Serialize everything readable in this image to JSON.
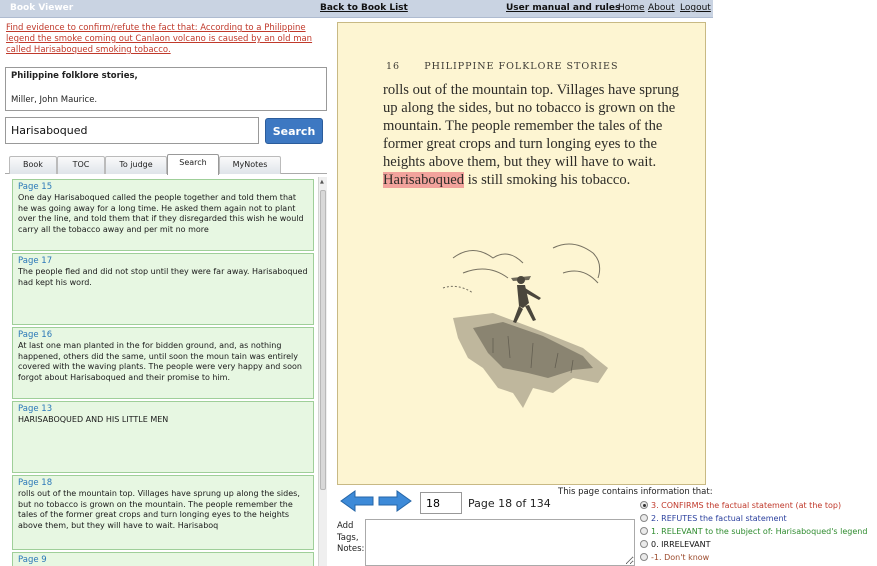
{
  "header": {
    "app_title": "Book Viewer",
    "back_link": "Back to Book List",
    "manual_link": "User manual and rules",
    "home_link": "Home",
    "about_link": "About",
    "logout_link": "Logout"
  },
  "task": "Find evidence to confirm/refute the fact that: According to a Philippine legend the smoke coming out Canlaon volcano is caused by an old man called Harisaboqued smoking tobacco.",
  "book": {
    "title": "Philippine folklore stories,",
    "author": "Miller, John Maurice."
  },
  "search": {
    "query": "Harisaboqued",
    "button_label": "Search"
  },
  "tabs": [
    "Book",
    "TOC",
    "To judge",
    "Search",
    "MyNotes"
  ],
  "active_tab": "Search",
  "results": [
    {
      "page": "Page 15",
      "text": "One day Harisaboqued called the people together and told them that he was going away for a long time. He asked them again not to plant over the line, and told them that if they disregarded this wish he would carry all the tobacco away and per mit no more"
    },
    {
      "page": "Page 17",
      "text": "The people fled and did not stop until they were far away. Harisaboqued had kept his word."
    },
    {
      "page": "Page 16",
      "text": "At last one man planted in the for bidden ground, and, as nothing happened, others did the same, until soon the moun tain was entirely covered with the waving plants. The people were very happy and soon forgot about Harisaboqued and their promise to him."
    },
    {
      "page": "Page 13",
      "text": "HARISABOQUED AND HIS LITTLE MEN"
    },
    {
      "page": "Page 18",
      "text": "rolls out of the mountain top. Villages have sprung up along the sides, but no tobacco is grown on the mountain. The people remember the tales of the former great crops and turn longing eyes to the heights above them, but they will have to wait. Harisaboq"
    },
    {
      "page": "Page 9",
      "text": ""
    }
  ],
  "page_view": {
    "page_number": "16",
    "running_head": "PHILIPPINE FOLKLORE STORIES",
    "text_before": "rolls out of the mountain top. Villages have sprung up along the sides, but no tobacco is grown on the mountain. The people remember the tales of the former great crops and turn longing eyes to the heights above them, but they will have to wait. ",
    "highlight": "Harisaboqued",
    "text_after": " is still smoking his tobacco."
  },
  "navigation": {
    "page_input": "18",
    "page_of": "Page 18 of 134"
  },
  "notes_label": "Add Tags, Notes:",
  "judgement": {
    "prompt": "This page contains information that:",
    "selected_index": 0,
    "options": [
      {
        "label": "3. CONFIRMS the factual statement (at the top)",
        "color": "#c0392b"
      },
      {
        "label": "2. REFUTES the factual statement",
        "color": "#2a3f9d"
      },
      {
        "label": "1. RELEVANT to the subject of: Harisaboqued's legend",
        "color": "#2e8b2e"
      },
      {
        "label": "0. IRRELEVANT",
        "color": "#111111"
      },
      {
        "label": "-1. Don't know",
        "color": "#9b4a2c"
      }
    ]
  }
}
